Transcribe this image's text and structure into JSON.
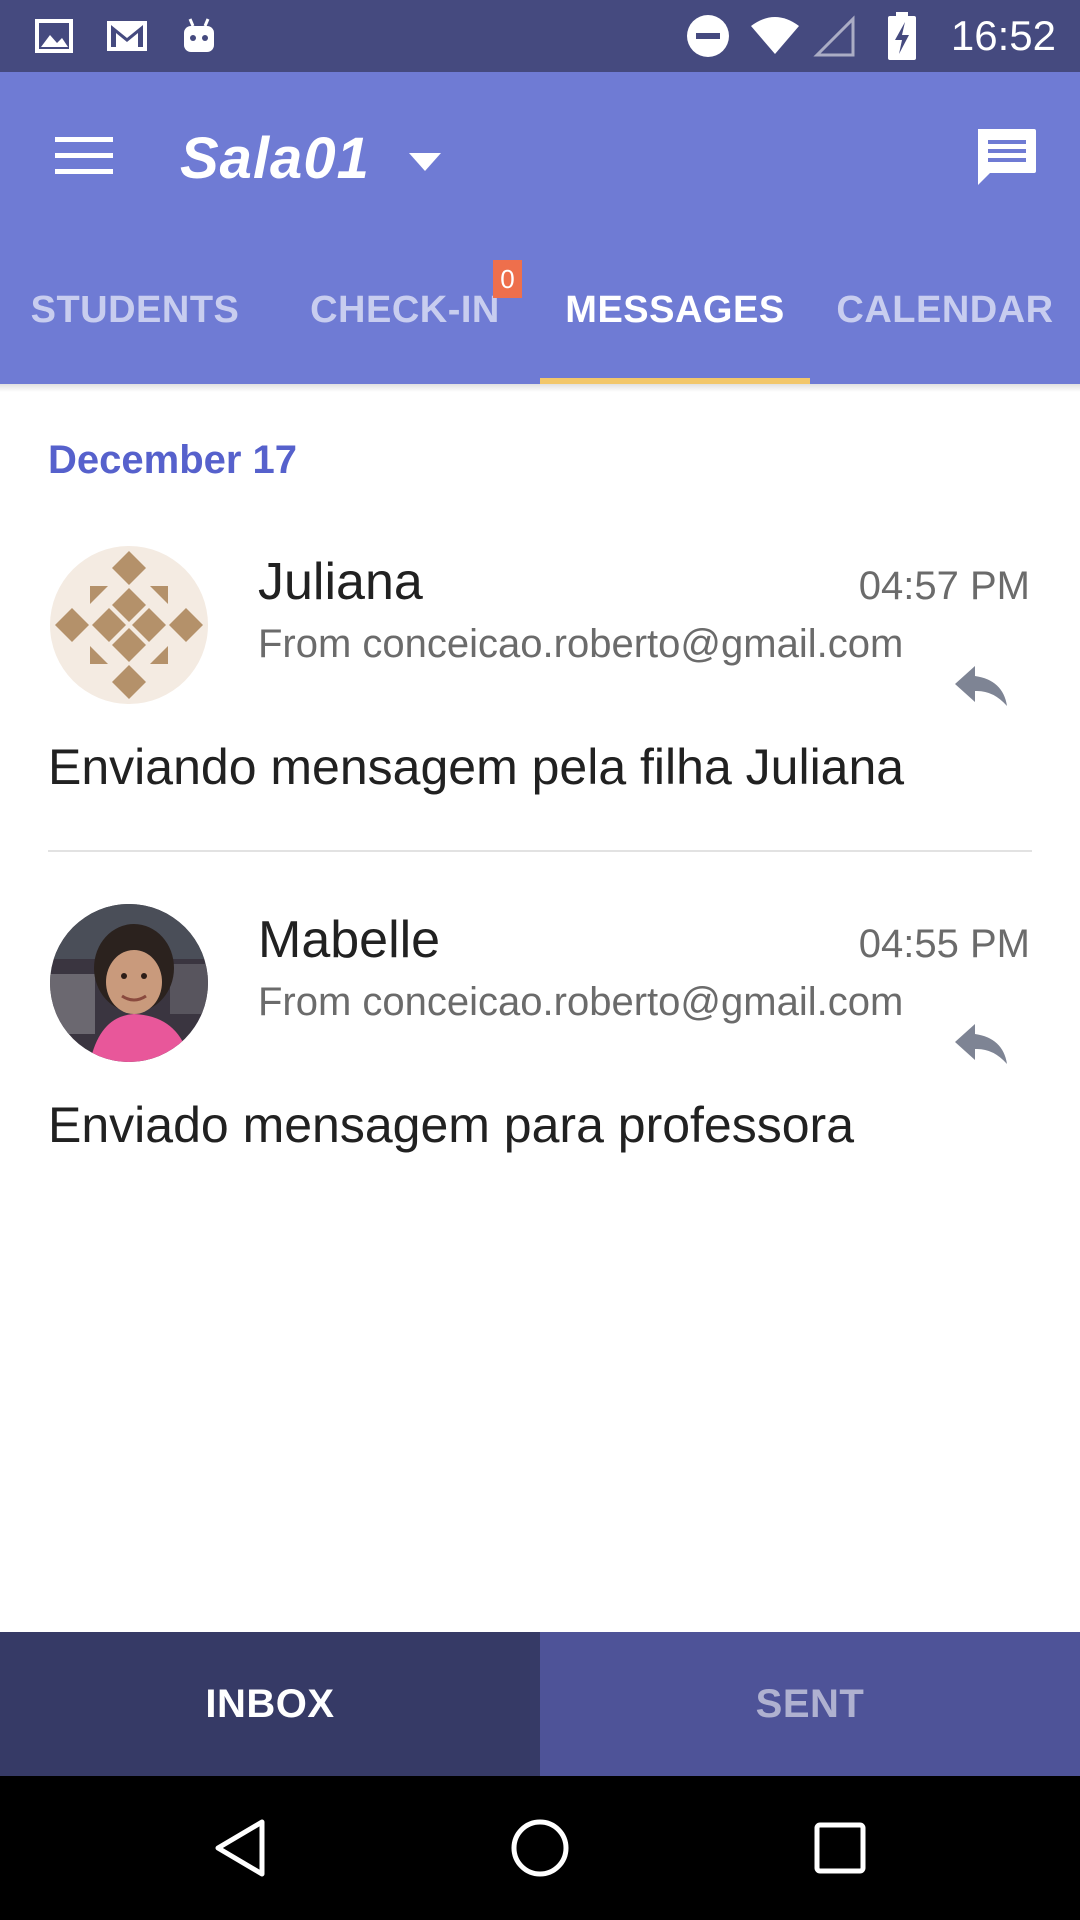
{
  "status_bar": {
    "time": "16:52",
    "icons": [
      "image-icon",
      "gmail-icon",
      "android-icon",
      "do-not-disturb-icon",
      "wifi-icon",
      "signal-icon",
      "battery-charging-icon"
    ]
  },
  "app_bar": {
    "room_title": "Sala01",
    "menu_icon": "hamburger-menu-icon",
    "dropdown_icon": "caret-down-icon",
    "compose_icon": "message-icon",
    "tabs": [
      {
        "label": "STUDENTS",
        "active": false
      },
      {
        "label": "CHECK-IN",
        "active": false,
        "badge": "0"
      },
      {
        "label": "MESSAGES",
        "active": true
      },
      {
        "label": "CALENDAR",
        "active": false
      }
    ]
  },
  "messages_list": {
    "date_header": "December 17",
    "items": [
      {
        "sender": "Juliana",
        "time": "04:57 PM",
        "from": "From conceicao.roberto@gmail.com",
        "body": "Enviando mensagem pela filha Juliana",
        "avatar": "pattern-avatar"
      },
      {
        "sender": "Mabelle",
        "time": "04:55 PM",
        "from": "From conceicao.roberto@gmail.com",
        "body": "Enviado mensagem para professora",
        "avatar": "photo-avatar"
      }
    ]
  },
  "bottom_tabs": {
    "inbox": "INBOX",
    "sent": "SENT",
    "active": "INBOX"
  },
  "nav_bar": {
    "icons": [
      "back-icon",
      "home-icon",
      "recents-icon"
    ]
  },
  "colors": {
    "status_bar": "#454a7f",
    "app_bar": "#6f7bd4",
    "tab_indicator": "#f2c76a",
    "badge": "#ee6f4c",
    "date_header": "#5661cc",
    "inbox_tab": "#363a66",
    "sent_tab": "#4e5398"
  }
}
